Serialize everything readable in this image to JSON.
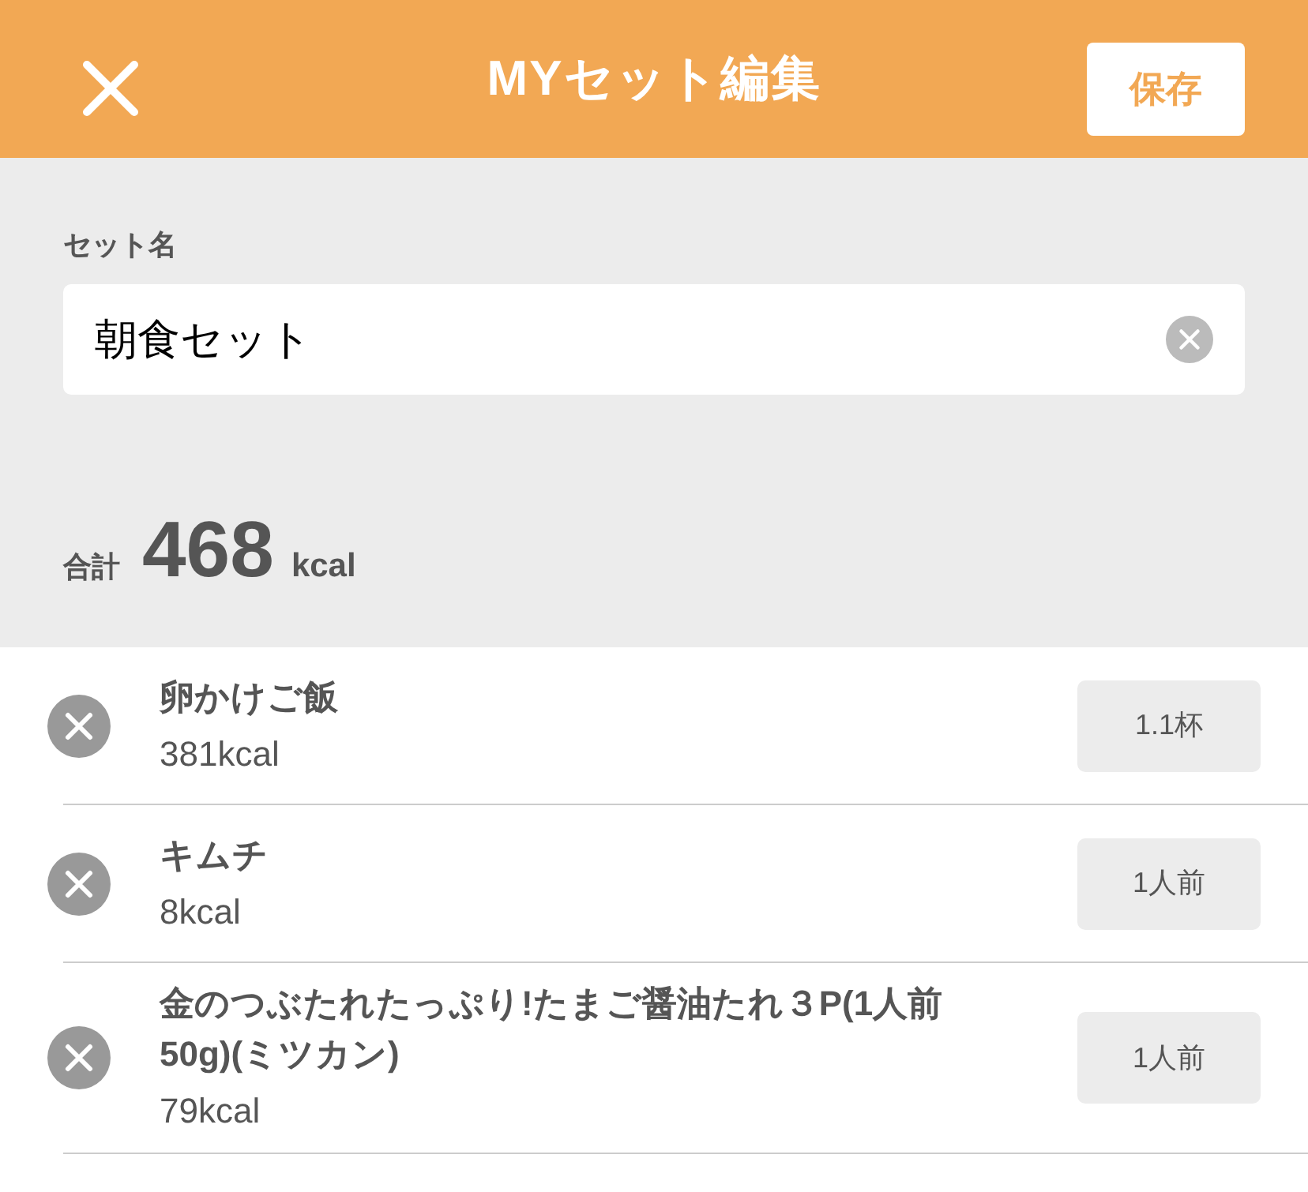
{
  "header": {
    "title": "MYセット編集",
    "save_button": "保存"
  },
  "set_name": {
    "label": "セット名",
    "value": "朝食セット"
  },
  "total": {
    "label": "合計",
    "amount": "468",
    "unit": "kcal"
  },
  "items": [
    {
      "name": "卵かけご飯",
      "kcal": "381kcal",
      "quantity": "1.1杯"
    },
    {
      "name": "キムチ",
      "kcal": "8kcal",
      "quantity": "1人前"
    },
    {
      "name": "金のつぶたれたっぷり!たまご醤油たれ３P(1人前 50g)(ミツカン)",
      "kcal": "79kcal",
      "quantity": "1人前"
    }
  ]
}
